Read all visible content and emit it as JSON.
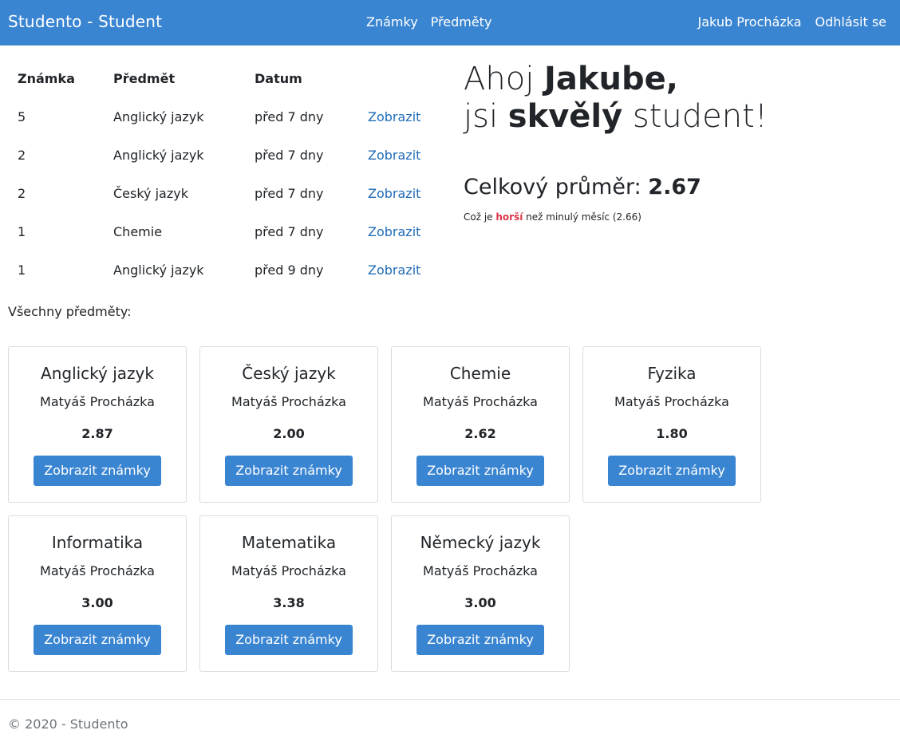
{
  "navbar": {
    "brand": "Studento - Student",
    "links": [
      "Známky",
      "Předměty"
    ],
    "user_name": "Jakub Procházka",
    "logout": "Odhlásit se"
  },
  "grades": {
    "headers": [
      "Známka",
      "Předmět",
      "Datum"
    ],
    "rows": [
      {
        "grade": "5",
        "subject": "Anglický jazyk",
        "date": "před 7 dny",
        "action": "Zobrazit"
      },
      {
        "grade": "2",
        "subject": "Anglický jazyk",
        "date": "před 7 dny",
        "action": "Zobrazit"
      },
      {
        "grade": "2",
        "subject": "Český jazyk",
        "date": "před 7 dny",
        "action": "Zobrazit"
      },
      {
        "grade": "1",
        "subject": "Chemie",
        "date": "před 7 dny",
        "action": "Zobrazit"
      },
      {
        "grade": "1",
        "subject": "Anglický jazyk",
        "date": "před 9 dny",
        "action": "Zobrazit"
      }
    ]
  },
  "greeting": {
    "line1_prefix": "Ahoj ",
    "name": "Jakube,",
    "line2_prefix": "jsi ",
    "adjective": "skvělý",
    "line2_suffix": " student!"
  },
  "summary": {
    "average_label": "Celkový průměr: ",
    "average_value": "2.67",
    "compare_prefix": "Což je ",
    "compare_word": "horší",
    "compare_suffix": " než minulý měsíc (2.66)",
    "compare_color": "#dc3545"
  },
  "subjects_heading": "Všechny předměty:",
  "subjects": [
    {
      "name": "Anglický jazyk",
      "teacher": "Matyáš Procházka",
      "average": "2.87",
      "button": "Zobrazit známky"
    },
    {
      "name": "Český jazyk",
      "teacher": "Matyáš Procházka",
      "average": "2.00",
      "button": "Zobrazit známky"
    },
    {
      "name": "Chemie",
      "teacher": "Matyáš Procházka",
      "average": "2.62",
      "button": "Zobrazit známky"
    },
    {
      "name": "Fyzika",
      "teacher": "Matyáš Procházka",
      "average": "1.80",
      "button": "Zobrazit známky"
    },
    {
      "name": "Informatika",
      "teacher": "Matyáš Procházka",
      "average": "3.00",
      "button": "Zobrazit známky"
    },
    {
      "name": "Matematika",
      "teacher": "Matyáš Procházka",
      "average": "3.38",
      "button": "Zobrazit známky"
    },
    {
      "name": "Německý jazyk",
      "teacher": "Matyáš Procházka",
      "average": "3.00",
      "button": "Zobrazit známky"
    }
  ],
  "footer": {
    "text": "© 2020 - Studento"
  },
  "colors": {
    "brand": "#3a85d2",
    "link": "#1f6bb8"
  }
}
